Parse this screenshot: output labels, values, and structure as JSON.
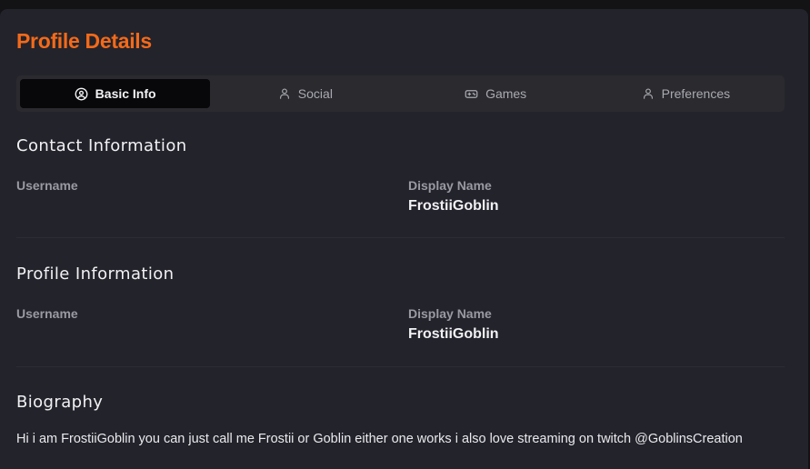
{
  "page": {
    "title": "Profile Details"
  },
  "tabs": [
    {
      "label": "Basic Info",
      "icon": "user-circle-icon",
      "active": true
    },
    {
      "label": "Social",
      "icon": "user-icon",
      "active": false
    },
    {
      "label": "Games",
      "icon": "gamepad-icon",
      "active": false
    },
    {
      "label": "Preferences",
      "icon": "user-icon",
      "active": false
    }
  ],
  "contact": {
    "heading": "Contact Information",
    "username_label": "Username",
    "username_value": "",
    "display_name_label": "Display Name",
    "display_name_value": "FrostiiGoblin"
  },
  "profile": {
    "heading": "Profile Information",
    "username_label": "Username",
    "username_value": "",
    "display_name_label": "Display Name",
    "display_name_value": "FrostiiGoblin"
  },
  "biography": {
    "heading": "Biography",
    "text": "Hi i am FrostiiGoblin you can just call me Frostii or Goblin either one works i also love streaming on twitch @GoblinsCreation"
  },
  "colors": {
    "accent": "#f36a1a",
    "panel": "#23232b",
    "background": "#131316",
    "active_tab": "#08080a"
  }
}
